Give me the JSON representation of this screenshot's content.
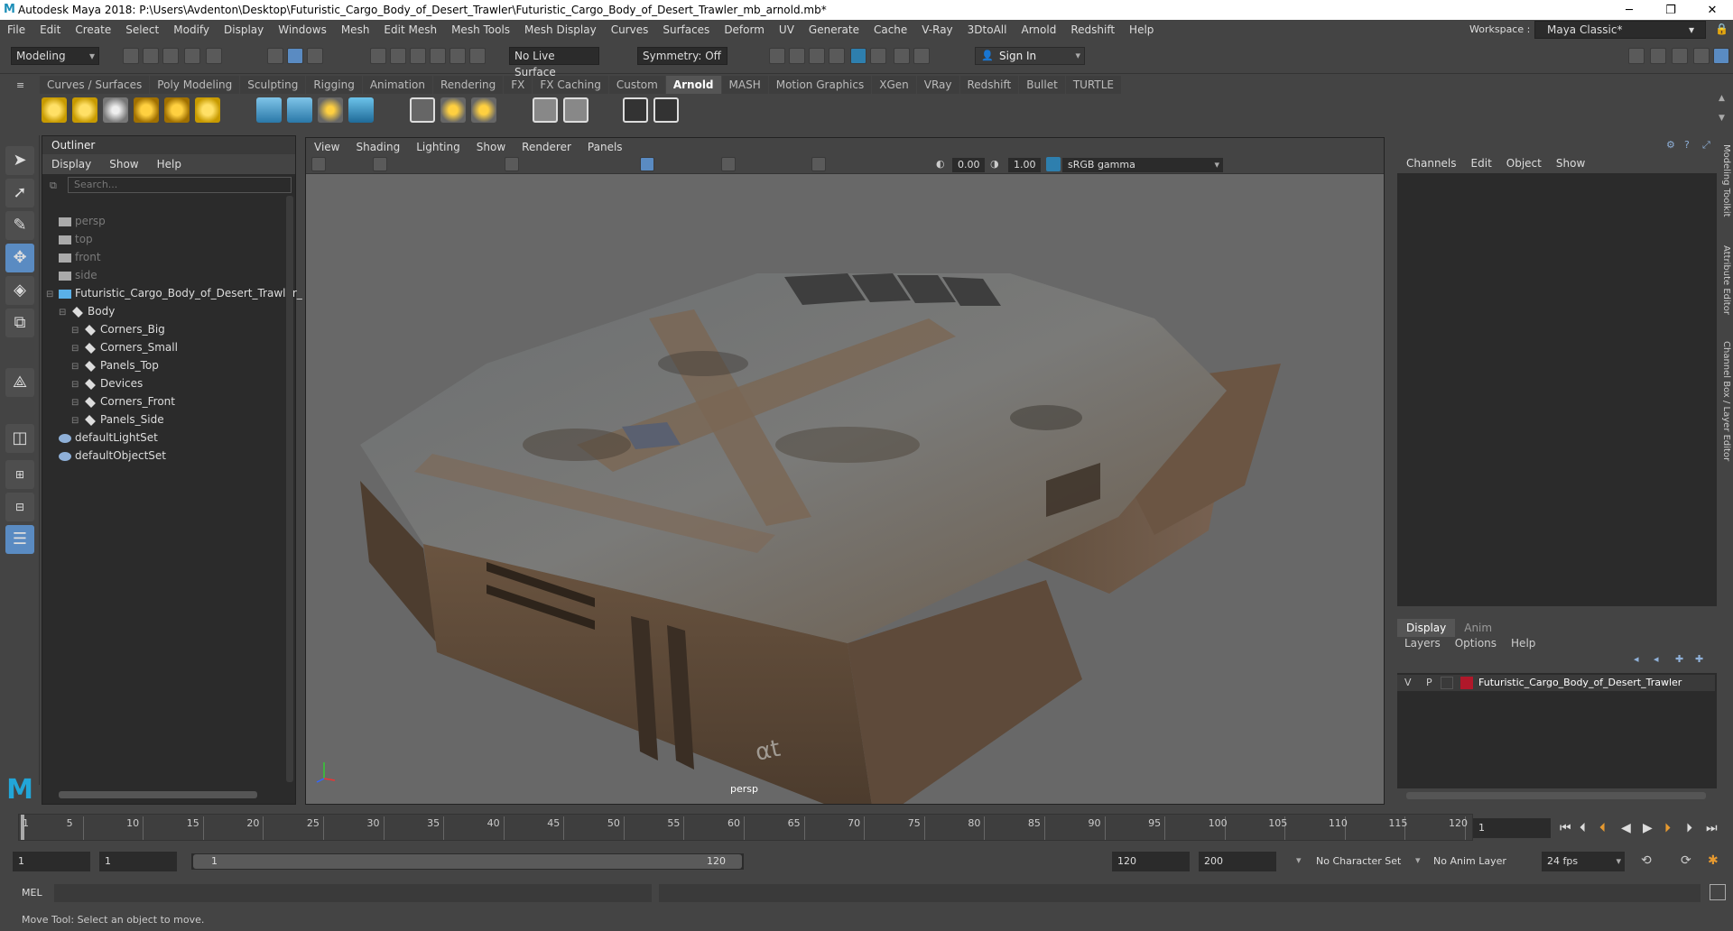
{
  "titlebar": {
    "title": "Autodesk Maya 2018: P:\\Users\\Avdenton\\Desktop\\Futuristic_Cargo_Body_of_Desert_Trawler\\Futuristic_Cargo_Body_of_Desert_Trawler_mb_arnold.mb*",
    "minimize": "─",
    "maximize": "❐",
    "close": "✕"
  },
  "menubar": [
    "File",
    "Edit",
    "Create",
    "Select",
    "Modify",
    "Display",
    "Windows",
    "Mesh",
    "Edit Mesh",
    "Mesh Tools",
    "Mesh Display",
    "Curves",
    "Surfaces",
    "Deform",
    "UV",
    "Generate",
    "Cache",
    "V-Ray",
    "3DtoAll",
    "Arnold",
    "Redshift",
    "Help"
  ],
  "workspace": {
    "label": "Workspace :",
    "value": "Maya Classic*"
  },
  "statusline": {
    "mode": "Modeling",
    "live_surface": "No Live Surface",
    "symmetry": "Symmetry: Off",
    "sign_in": "Sign In"
  },
  "shelf_tabs": [
    "Curves / Surfaces",
    "Poly Modeling",
    "Sculpting",
    "Rigging",
    "Animation",
    "Rendering",
    "FX",
    "FX Caching",
    "Custom",
    "Arnold",
    "MASH",
    "Motion Graphics",
    "XGen",
    "VRay",
    "Redshift",
    "Bullet",
    "TURTLE"
  ],
  "active_shelf": "Arnold",
  "outliner": {
    "title": "Outliner",
    "menu": [
      "Display",
      "Show",
      "Help"
    ],
    "search_placeholder": "Search...",
    "items": [
      {
        "label": "persp",
        "dim": true,
        "indent": 1,
        "icon": "camera-icon"
      },
      {
        "label": "top",
        "dim": true,
        "indent": 1,
        "icon": "camera-icon"
      },
      {
        "label": "front",
        "dim": true,
        "indent": 1,
        "icon": "camera-icon"
      },
      {
        "label": "side",
        "dim": true,
        "indent": 1,
        "icon": "camera-icon"
      },
      {
        "label": "Futuristic_Cargo_Body_of_Desert_Trawler_",
        "dim": false,
        "indent": 1,
        "icon": "group-icon",
        "expand": "−"
      },
      {
        "label": "Body",
        "dim": false,
        "indent": 2,
        "icon": "mesh-icon",
        "expand": "−"
      },
      {
        "label": "Corners_Big",
        "dim": false,
        "indent": 3,
        "icon": "mesh-icon",
        "expand": "+"
      },
      {
        "label": "Corners_Small",
        "dim": false,
        "indent": 3,
        "icon": "mesh-icon",
        "expand": "+"
      },
      {
        "label": "Panels_Top",
        "dim": false,
        "indent": 3,
        "icon": "mesh-icon",
        "expand": "+"
      },
      {
        "label": "Devices",
        "dim": false,
        "indent": 3,
        "icon": "mesh-icon",
        "expand": "+"
      },
      {
        "label": "Corners_Front",
        "dim": false,
        "indent": 3,
        "icon": "mesh-icon",
        "expand": "+"
      },
      {
        "label": "Panels_Side",
        "dim": false,
        "indent": 3,
        "icon": "mesh-icon",
        "expand": "+"
      },
      {
        "label": "defaultLightSet",
        "dim": false,
        "indent": 1,
        "icon": "set-icon"
      },
      {
        "label": "defaultObjectSet",
        "dim": false,
        "indent": 1,
        "icon": "set-icon"
      }
    ]
  },
  "viewport": {
    "menu": [
      "View",
      "Shading",
      "Lighting",
      "Show",
      "Renderer",
      "Panels"
    ],
    "exposure": "0.00",
    "gamma": "1.00",
    "color_space": "sRGB gamma",
    "camera_label": "persp"
  },
  "channelbox": {
    "menu": [
      "Channels",
      "Edit",
      "Object",
      "Show"
    ],
    "layer_tabs": [
      "Display",
      "Anim"
    ],
    "layer_menu": [
      "Layers",
      "Options",
      "Help"
    ],
    "layer": {
      "v": "V",
      "p": "P",
      "name": "Futuristic_Cargo_Body_of_Desert_Trawler",
      "color": "#b0182a"
    }
  },
  "side_tabs": [
    "Modeling Toolkit",
    "Attribute Editor",
    "Channel Box / Layer Editor"
  ],
  "timeline": {
    "ticks": [
      "5",
      "10",
      "15",
      "20",
      "25",
      "30",
      "35",
      "40",
      "45",
      "50",
      "55",
      "60",
      "65",
      "70",
      "75",
      "80",
      "85",
      "90",
      "95",
      "100",
      "105",
      "110",
      "115",
      "120"
    ],
    "first_tick": "1",
    "current_frame": "1"
  },
  "range": {
    "start": "1",
    "playback_start": "1",
    "slider_start": "1",
    "slider_end": "120",
    "playback_end": "120",
    "end": "200",
    "character_set": "No Character Set",
    "anim_layer": "No Anim Layer",
    "fps": "24 fps"
  },
  "mel": {
    "label": "MEL"
  },
  "helpline": "Move Tool: Select an object to move."
}
